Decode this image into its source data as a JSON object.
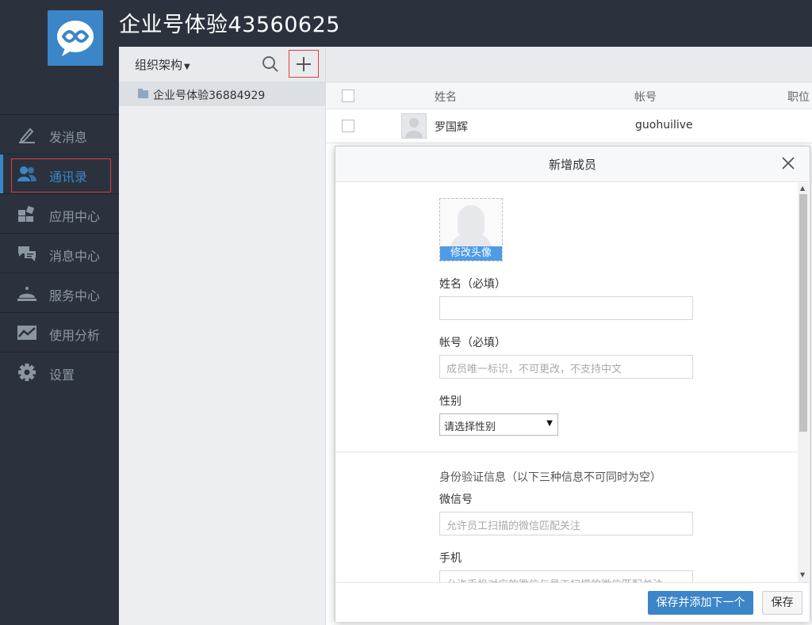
{
  "header": {
    "title": "企业号体验43560625"
  },
  "nav": {
    "items": [
      {
        "label": "发消息",
        "icon": "pencil-icon"
      },
      {
        "label": "通讯录",
        "icon": "contacts-icon",
        "active": true
      },
      {
        "label": "应用中心",
        "icon": "apps-icon"
      },
      {
        "label": "消息中心",
        "icon": "messages-icon"
      },
      {
        "label": "服务中心",
        "icon": "service-bell-icon"
      },
      {
        "label": "使用分析",
        "icon": "analytics-icon"
      },
      {
        "label": "设置",
        "icon": "gear-icon"
      }
    ]
  },
  "org": {
    "title": "组织架构",
    "items": [
      {
        "label": "企业号体验36884929"
      }
    ]
  },
  "table": {
    "columns": [
      "姓名",
      "帐号",
      "职位"
    ],
    "rows": [
      {
        "name": "罗国辉",
        "account": "guohuilive"
      }
    ]
  },
  "modal": {
    "title": "新增成员",
    "avatar_label": "修改头像",
    "name_label": "姓名（必填）",
    "name_value": "",
    "account_label": "帐号（必填）",
    "account_placeholder": "成员唯一标识，不可更改，不支持中文",
    "gender_label": "性别",
    "gender_selected": "请选择性别",
    "identity_note": "身份验证信息（以下三种信息不可同时为空）",
    "wechat_label": "微信号",
    "wechat_placeholder": "允许员工扫描的微信匹配关注",
    "phone_label": "手机",
    "phone_placeholder": "允许手机对应的微信与员工扫描的微信匹配关注",
    "save_add_next": "保存并添加下一个",
    "save": "保存"
  },
  "colors": {
    "accent": "#3b85c9",
    "sidebar_bg": "#2b323d",
    "highlight_border": "#e03c3c"
  }
}
